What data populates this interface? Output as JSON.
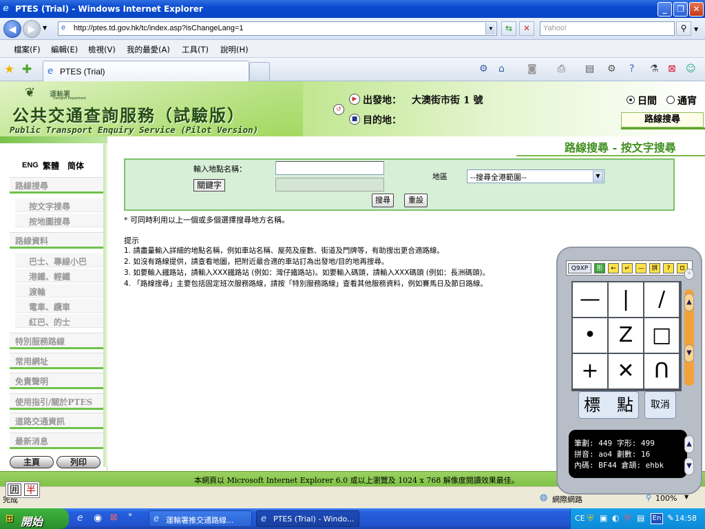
{
  "window": {
    "title": "PTES (Trial) - Windows Internet Explorer",
    "minimize": "_",
    "maximize": "❐",
    "close": "✕"
  },
  "browser": {
    "address": "http://ptes.td.gov.hk/tc/index.asp?isChangeLang=1",
    "search_placeholder": "Yahoo!",
    "menu": [
      "檔案(F)",
      "編輯(E)",
      "檢視(V)",
      "我的最愛(A)",
      "工具(T)",
      "說明(H)"
    ],
    "tab_label": "PTES (Trial)",
    "zoom": "100%",
    "status_zone": "網際網路",
    "status_left": "完成"
  },
  "banner": {
    "logo_text": "運輸署",
    "logo_subtext": "Transport Department",
    "title": "公共交通查詢服務（試驗版）",
    "subtitle": "Public Transport Enquiry Service (Pilot Version)",
    "origin_label": "出發地：",
    "origin_value": "大澳街市街 1 號",
    "destination_label": "目的地：",
    "time_day": "日間",
    "time_overnight": "通宵",
    "section_tag": "路線搜尋"
  },
  "sidebar": {
    "lang": [
      "ENG",
      "繁體",
      "简体"
    ],
    "sections": [
      {
        "label": "路線搜尋",
        "subs": [
          "按文字搜尋",
          "按地圖搜尋"
        ]
      },
      {
        "label": "路線資料",
        "subs": [
          "巴士、專線小巴",
          "港鐵、輕鐵",
          "渡輪",
          "電車、纜車",
          "紅巴、的士"
        ]
      },
      {
        "label": "特別服務路線",
        "subs": []
      },
      {
        "label": "常用網址",
        "subs": []
      },
      {
        "label": "免責聲明",
        "subs": []
      },
      {
        "label": "使用指引/關於PTES",
        "subs": []
      },
      {
        "label": "道路交通資訊",
        "subs": []
      },
      {
        "label": "最新消息",
        "subs": []
      }
    ],
    "home": "主頁",
    "print": "列印"
  },
  "main": {
    "heading": "路線搜尋 - 按文字搜尋",
    "input_label": "輸入地點名稱：",
    "keyword_button": "關鍵字",
    "district_label": "地區",
    "district_value": "--搜尋全港範圍--",
    "search_button": "搜尋",
    "reset_button": "重設",
    "note": "* 可同時利用以上一個或多個選擇搜尋地方名稱。",
    "tips_title": "提示",
    "tips": [
      "1.  請盡量輸入詳細的地點名稱，例如車站名稱、屋苑及座數、街道及門牌等，有助搜出更合適路線。",
      "2.  如沒有路線提供，請查看地圖，把附近最合適的車站訂為出發地/目的地再搜尋。",
      "3.  如要輸入鐵路站，請輸入XXX鐵路站 (例如：灣仔鐵路站)。如要輸入碼頭，請輸入XXX碼頭 (例如：長洲碼頭)。",
      "4.  「路線搜尋」主要包括固定班次服務路線，請按「特別服務路線」查看其他服務資料，例如賽馬日及節日路線。"
    ],
    "footer": "本網頁以 Microsoft Internet Explorer 6.0 或以上瀏覽及 1024 x 768 解像度閱讀效果最佳。"
  },
  "ime": {
    "toolbar": [
      "Q9XP",
      "形",
      "←",
      "↵",
      "—",
      "拼",
      "?",
      "⊡"
    ],
    "strokes": [
      "—",
      "|",
      "/",
      "•",
      "Z",
      "□",
      "+",
      "✕",
      "ᑎ"
    ],
    "big_label": "標　點",
    "cancel": "取消",
    "info_lines": [
      "筆劃: 449 字形: 499",
      "拼音: ao4 劃數: 16",
      "內碼: BF44 倉頡: ehbk"
    ],
    "small_left": "囲",
    "small_right": "半"
  },
  "taskbar": {
    "start": "開始",
    "tasks": [
      "運輸署推交通路線...",
      "PTES (Trial) - Windo..."
    ],
    "lang": "En",
    "ce": "CE",
    "clock": "14:58"
  }
}
